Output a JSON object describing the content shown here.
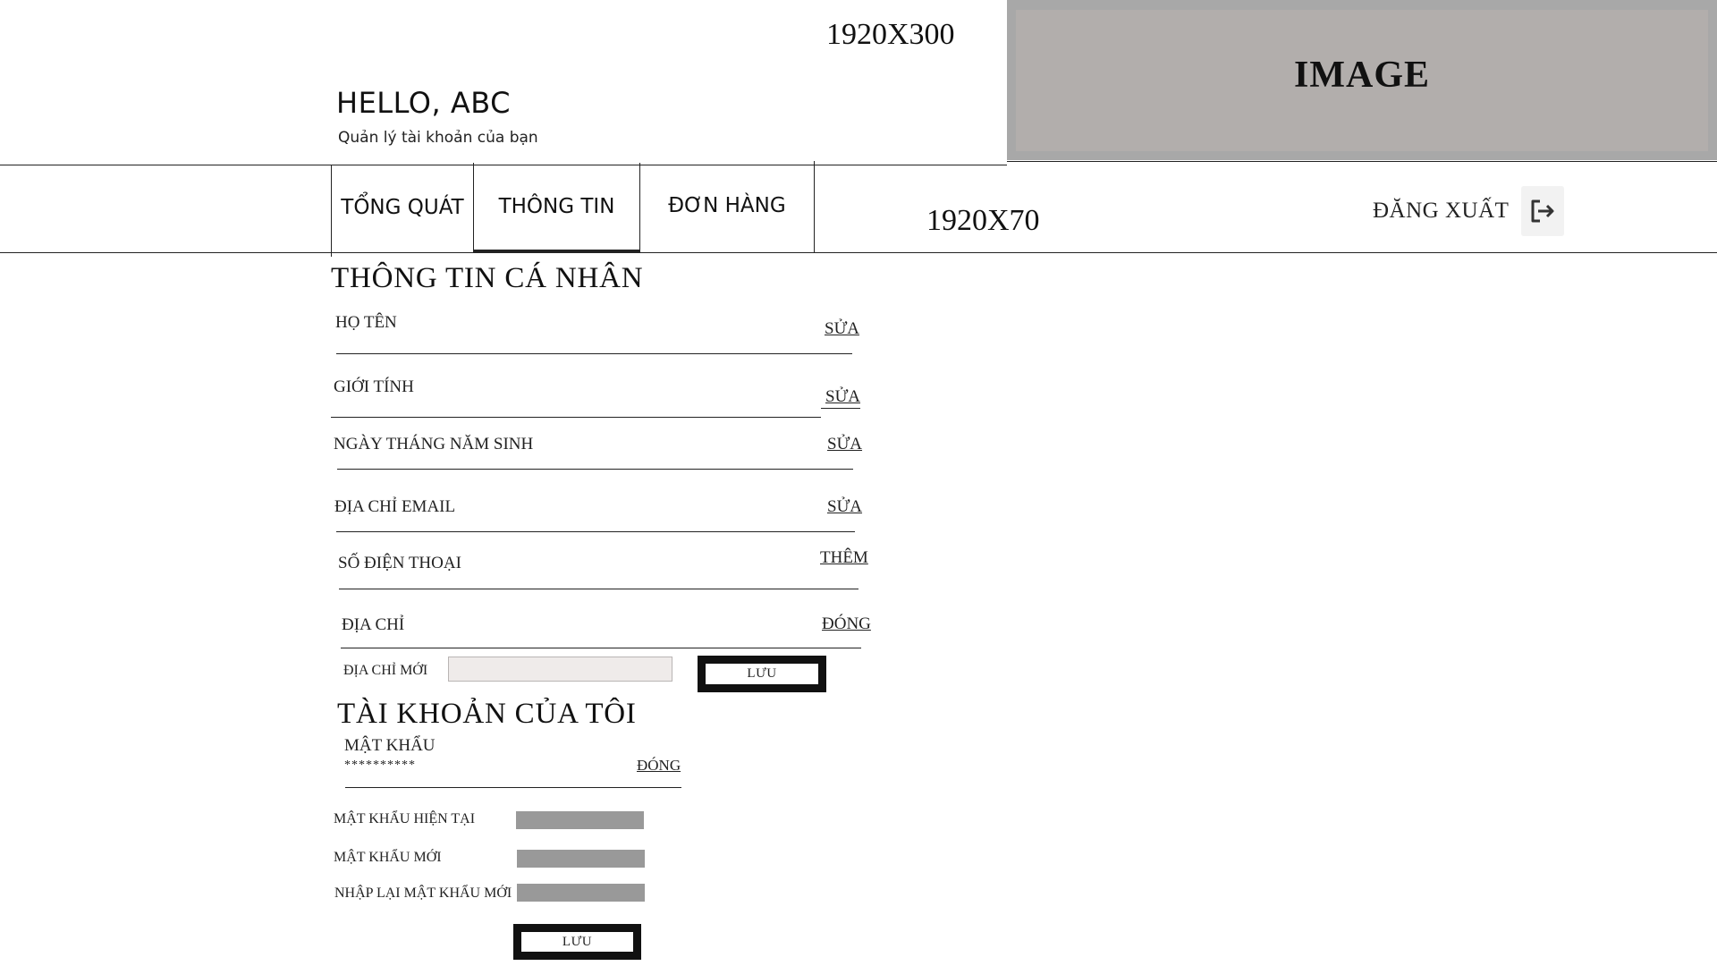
{
  "header": {
    "size_label": "1920X300",
    "greeting": "HELLO, ABC",
    "subtitle": "Quản lý tài khoản của bạn",
    "image_placeholder": "IMAGE"
  },
  "nav": {
    "tabs": [
      {
        "label": "TỔNG QUÁT",
        "active": false
      },
      {
        "label": "THÔNG TIN",
        "active": true
      },
      {
        "label": "ĐƠN HÀNG",
        "active": false
      }
    ],
    "size_label": "1920X70",
    "logout_label": "ĐĂNG XUẤT",
    "logout_icon": "logout-icon"
  },
  "personal_info": {
    "title": "THÔNG TIN CÁ NHÂN",
    "fields": [
      {
        "label": "HỌ TÊN",
        "action": "SỬA"
      },
      {
        "label": "GIỚI TÍNH",
        "action": "SỬA"
      },
      {
        "label": "NGÀY THÁNG NĂM SINH",
        "action": "SỬA"
      },
      {
        "label": "ĐỊA CHỈ EMAIL",
        "action": "SỬA"
      },
      {
        "label": "SỐ ĐIỆN THOẠI",
        "action": "THÊM"
      },
      {
        "label": "ĐỊA CHỈ",
        "action": "ĐÓNG"
      }
    ],
    "new_address": {
      "label": "ĐỊA CHỈ MỚI",
      "value": "",
      "save_label": "LƯU"
    }
  },
  "account": {
    "title": "TÀI KHOẢN CỦA TÔI",
    "password_label": "MẬT KHẨU",
    "password_mask": "**********",
    "close_label": "ĐÓNG",
    "current_password_label": "MẬT KHẨU HIỆN TẠI",
    "new_password_label": "MẬT KHẨU MỚI",
    "confirm_password_label": "NHẬP LẠI MẬT KHẨU MỚI",
    "save_label": "LƯU"
  },
  "colors": {
    "image_placeholder_outer": "#a8a8a8",
    "image_placeholder_inner": "#b2aeac",
    "password_input": "#999999",
    "address_input": "#efebea"
  }
}
